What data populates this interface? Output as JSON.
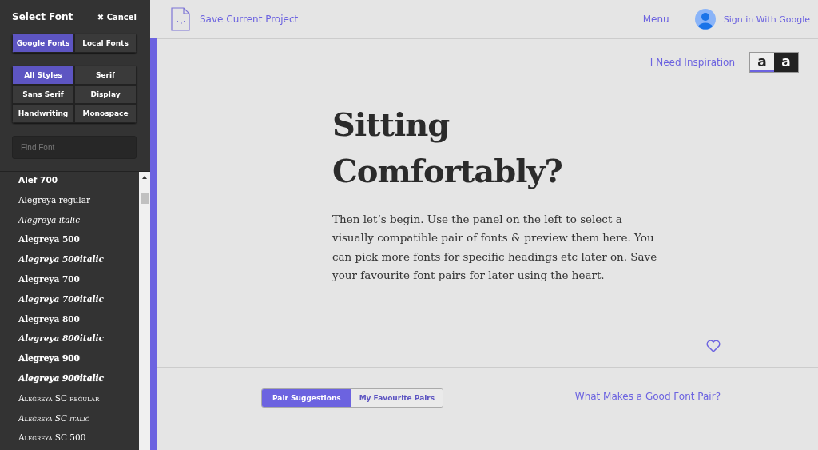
{
  "sidebar": {
    "title": "Select Font",
    "cancel": "✖ Cancel",
    "source_tabs": [
      {
        "label": "Google Fonts",
        "selected": true
      },
      {
        "label": "Local Fonts",
        "selected": false
      }
    ],
    "styles": [
      {
        "label": "All Styles",
        "selected": true
      },
      {
        "label": "Serif",
        "selected": false
      },
      {
        "label": "Sans Serif",
        "selected": false
      },
      {
        "label": "Display",
        "selected": false
      },
      {
        "label": "Handwriting",
        "selected": false
      },
      {
        "label": "Monospace",
        "selected": false
      }
    ],
    "search": {
      "placeholder": "Find Font"
    },
    "fonts": [
      {
        "name": "Alef 700",
        "kind": "sans-bold"
      },
      {
        "name": "Alegreya regular",
        "kind": "regular"
      },
      {
        "name": "Alegreya italic",
        "kind": "italic"
      },
      {
        "name": "Alegreya 500",
        "kind": "medium"
      },
      {
        "name": "Alegreya 500italic",
        "kind": "medium-italic"
      },
      {
        "name": "Alegreya 700",
        "kind": "bold"
      },
      {
        "name": "Alegreya 700italic",
        "kind": "bold-italic"
      },
      {
        "name": "Alegreya 800",
        "kind": "bold"
      },
      {
        "name": "Alegreya 800italic",
        "kind": "bold-italic"
      },
      {
        "name": "Alegreya 900",
        "kind": "black"
      },
      {
        "name": "Alegreya 900italic",
        "kind": "black-italic"
      },
      {
        "name": "Alegreya SC regular",
        "kind": "smallcaps"
      },
      {
        "name": "Alegreya SC italic",
        "kind": "smallcaps-italic"
      },
      {
        "name": "Alegreya SC 500",
        "kind": "smallcaps"
      }
    ]
  },
  "header": {
    "save": "Save Current Project",
    "menu": "Menu",
    "sign_in": "Sign in With Google"
  },
  "toolbar": {
    "inspiration": "I Need Inspiration",
    "themes": [
      {
        "label": "a",
        "kind": "light",
        "selected": true
      },
      {
        "label": "a",
        "kind": "dark",
        "selected": false
      }
    ]
  },
  "preview": {
    "heading": "Sitting Comfortably?",
    "body": "Then let’s begin. Use the panel on the left to select a visually compatible pair of fonts & preview them here. You can pick more fonts for specific headings etc later on. Save your favourite font pairs for later using the heart."
  },
  "footer": {
    "tabs": [
      {
        "label": "Pair Suggestions",
        "selected": true
      },
      {
        "label": "My Favourite Pairs",
        "selected": false
      }
    ],
    "link": "What Makes a Good Font Pair?"
  }
}
